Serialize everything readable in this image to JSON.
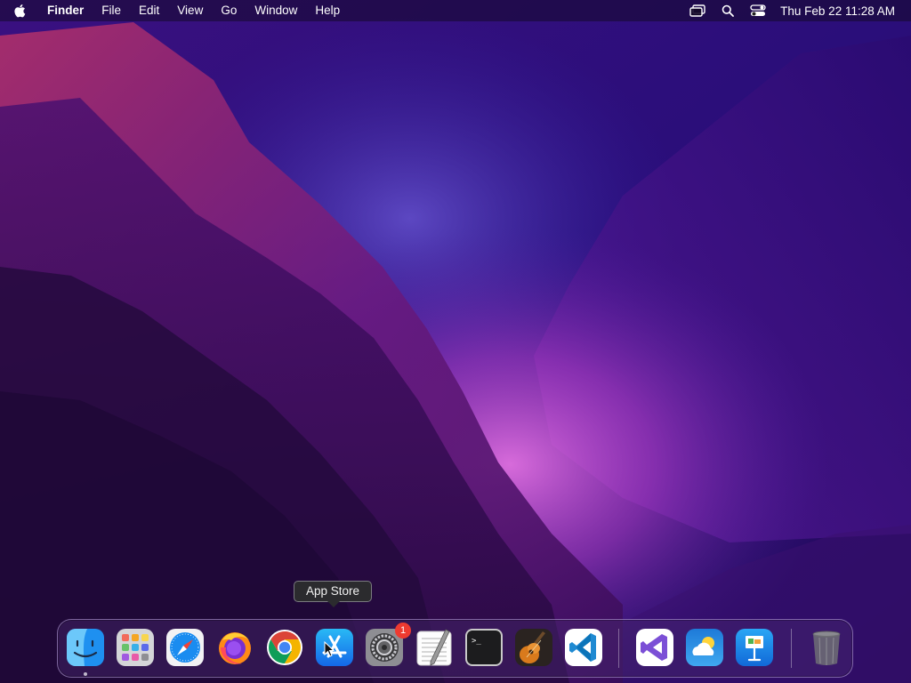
{
  "menubar": {
    "apple_icon": "apple-logo-icon",
    "app_name": "Finder",
    "menus": [
      "File",
      "Edit",
      "View",
      "Go",
      "Window",
      "Help"
    ],
    "status_icons": [
      "screen-mirroring-icon",
      "spotlight-search-icon",
      "control-center-icon"
    ],
    "clock": "Thu Feb 22  11:28 AM"
  },
  "tooltip": {
    "text": "App Store"
  },
  "dock": {
    "apps": [
      {
        "name": "Finder",
        "icon": "finder-icon",
        "running": true
      },
      {
        "name": "Launchpad",
        "icon": "launchpad-icon"
      },
      {
        "name": "Safari",
        "icon": "safari-icon"
      },
      {
        "name": "Firefox",
        "icon": "firefox-icon"
      },
      {
        "name": "Google Chrome",
        "icon": "chrome-icon"
      },
      {
        "name": "App Store",
        "icon": "app-store-icon"
      },
      {
        "name": "System Settings",
        "icon": "system-settings-icon",
        "badge": "1"
      },
      {
        "name": "TextEdit",
        "icon": "textedit-icon"
      },
      {
        "name": "Terminal",
        "icon": "terminal-icon"
      },
      {
        "name": "GarageBand",
        "icon": "garageband-icon"
      },
      {
        "name": "Visual Studio Code",
        "icon": "vscode-icon"
      },
      {
        "name": "Visual Studio",
        "icon": "visual-studio-icon"
      },
      {
        "name": "Weather",
        "icon": "weather-icon"
      },
      {
        "name": "Keynote",
        "icon": "keynote-icon"
      },
      {
        "name": "Trash",
        "icon": "trash-icon"
      }
    ]
  },
  "colors": {
    "wallpaper_base": "#1d0b4a",
    "wallpaper_glow": "#c040d0",
    "badge": "#ee3a30"
  }
}
